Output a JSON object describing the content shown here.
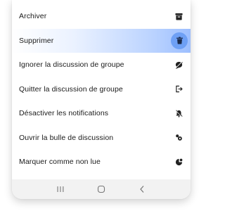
{
  "menu": {
    "items": [
      {
        "label": "Archiver",
        "icon": "archive-icon"
      },
      {
        "label": "Supprimer",
        "icon": "trash-icon",
        "highlighted": true
      },
      {
        "label": "Ignorer la discussion de groupe",
        "icon": "mute-conversation-icon"
      },
      {
        "label": "Quitter la discussion de groupe",
        "icon": "leave-icon"
      },
      {
        "label": "Désactiver les notifications",
        "icon": "notifications-off-icon"
      },
      {
        "label": "Ouvrir la bulle de discussion",
        "icon": "chat-bubble-icon"
      },
      {
        "label": "Marquer comme non lue",
        "icon": "mark-unread-icon"
      }
    ]
  },
  "navbar": {
    "buttons": [
      "recent-apps-icon",
      "home-icon",
      "back-icon"
    ]
  },
  "colors": {
    "highlight": "#b9d2ff",
    "highlight_icon_bg": "#6ea0f5",
    "text": "#1a1a1a",
    "navbar_bg": "#f2f2f2"
  }
}
